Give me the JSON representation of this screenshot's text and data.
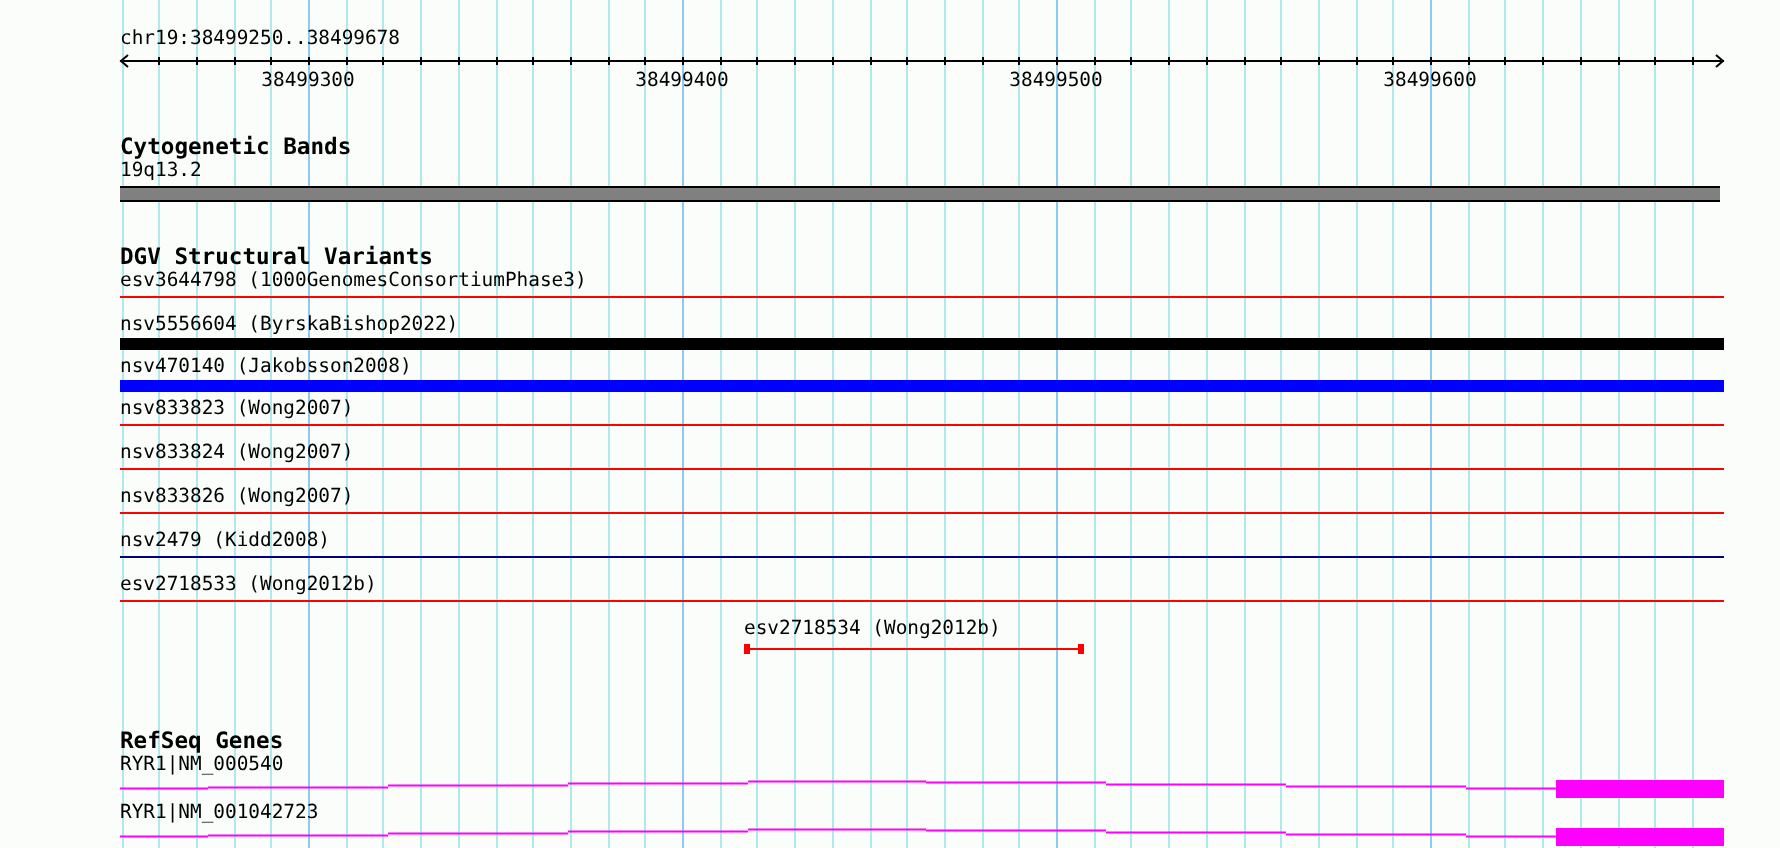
{
  "location": "chr19:38499250..38499678",
  "ruler": {
    "ticks": [
      "38499300",
      "38499400",
      "38499500",
      "38499600"
    ]
  },
  "tracks": [
    {
      "kind": "bands",
      "title": "Cytogenetic Bands",
      "features": [
        {
          "label": "19q13.2",
          "color": "#808080"
        }
      ]
    },
    {
      "kind": "variants",
      "title": "DGV Structural Variants",
      "features": [
        {
          "label": "esv3644798 (1000GenomesConsortiumPhase3)",
          "kind": "line",
          "color": "#ff0000"
        },
        {
          "label": "nsv5556604 (ByrskaBishop2022)",
          "kind": "bar",
          "color": "#000000"
        },
        {
          "label": "nsv470140 (Jakobsson2008)",
          "kind": "bar",
          "color": "#0000ff"
        },
        {
          "label": "nsv833823 (Wong2007)",
          "kind": "line",
          "color": "#ff0000"
        },
        {
          "label": "nsv833824 (Wong2007)",
          "kind": "line",
          "color": "#ff0000"
        },
        {
          "label": "nsv833826 (Wong2007)",
          "kind": "line",
          "color": "#ff0000"
        },
        {
          "label": "nsv2479 (Kidd2008)",
          "kind": "line",
          "color": "#000080"
        },
        {
          "label": "esv2718533 (Wong2012b)",
          "kind": "line",
          "color": "#ff0000"
        },
        {
          "label": "esv2718534 (Wong2012b)",
          "kind": "span",
          "color": "#ff0000"
        }
      ]
    },
    {
      "kind": "genes",
      "title": "RefSeq Genes",
      "features": [
        {
          "label": "RYR1|NM_000540",
          "color": "#ff00ff"
        },
        {
          "label": "RYR1|NM_001042723",
          "color": "#ff00ff"
        }
      ]
    }
  ]
}
